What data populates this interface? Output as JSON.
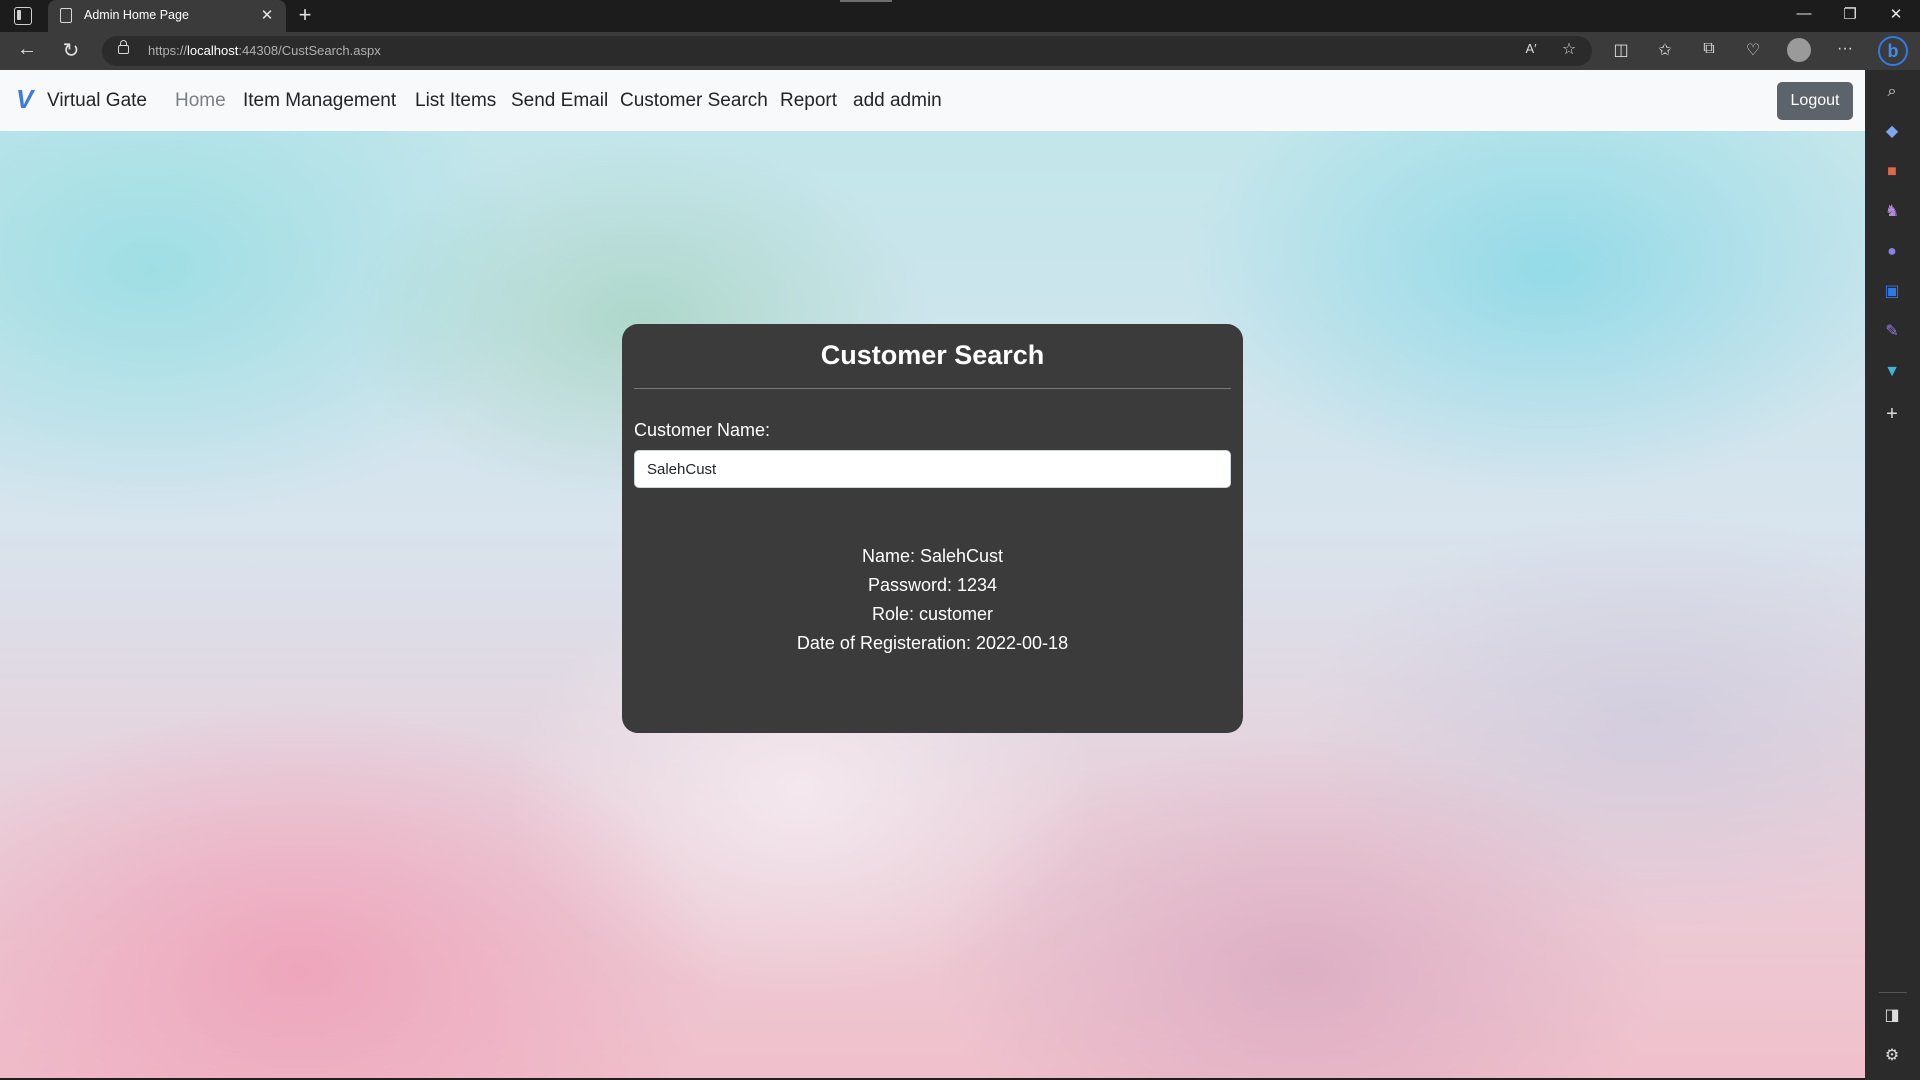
{
  "browser": {
    "tab_title": "Admin Home Page",
    "tab_close": "✕",
    "new_tab": "+",
    "url_scheme": "https://",
    "url_host": "localhost",
    "url_path": ":44308/CustSearch.aspx",
    "window_controls": [
      "—",
      "❐",
      "✕"
    ],
    "toolbar_icons": [
      "read-aloud-icon",
      "favorite-star-icon",
      "split-screen-icon",
      "favorites-icon",
      "collections-icon",
      "browser-essentials-icon",
      "profile-icon",
      "more-icon"
    ],
    "read_aloud_glyph": "A′",
    "more_glyph": "···",
    "bing_glyph": "b"
  },
  "sidebar": {
    "icons": [
      "search-icon",
      "shopping-tag-icon",
      "tools-icon",
      "games-icon",
      "copilot-icon",
      "outlook-icon",
      "editor-icon",
      "drop-icon",
      "add-icon",
      "hide-sidebar-icon",
      "settings-icon"
    ]
  },
  "navbar": {
    "brand_mark": "V",
    "brand": "Virtual Gate",
    "links": [
      "Home",
      "Item Management",
      "List Items",
      "Send Email",
      "Customer Search",
      "Report",
      "add admin"
    ],
    "logout": "Logout"
  },
  "card": {
    "title": "Customer Search",
    "label": "Customer Name:",
    "input_value": "SalehCust",
    "results": [
      "Name: SalehCust",
      "Password: 1234",
      "Role: customer",
      "Date of Registeration: 2022-00-18"
    ]
  },
  "colors": {
    "brand_accent": "#3d7be0",
    "card_bg": "#3b3b3b",
    "logout_bg": "#5c636a",
    "edge_accent": "#2f7ae5"
  }
}
